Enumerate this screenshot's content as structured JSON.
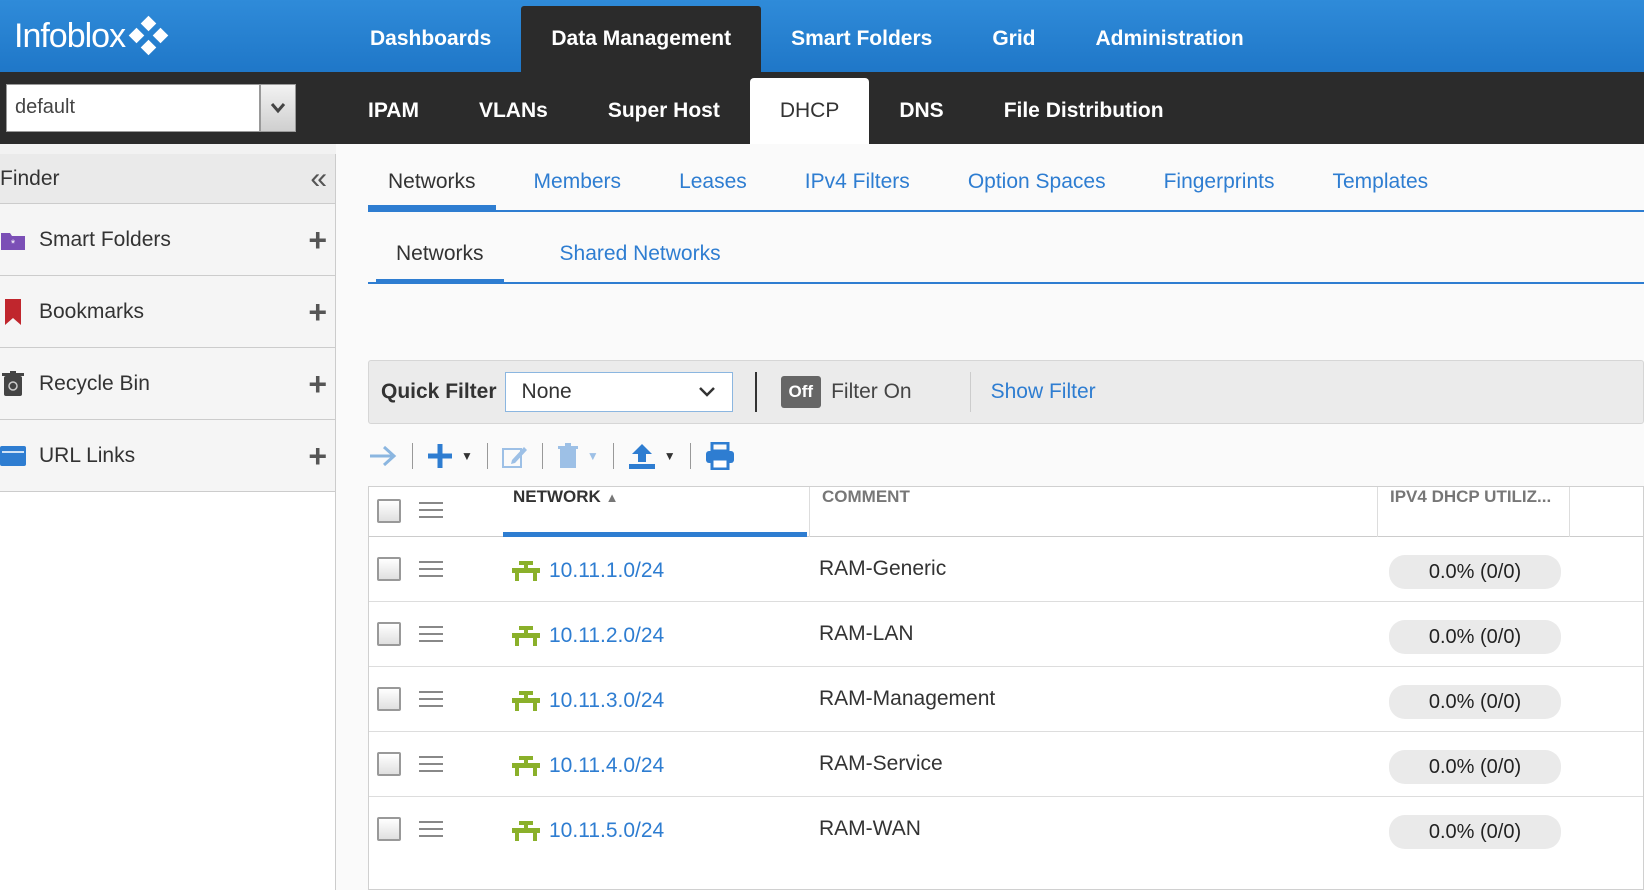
{
  "app": {
    "logo_text": "Infoblox"
  },
  "topnav": {
    "items": [
      "Dashboards",
      "Data Management",
      "Smart Folders",
      "Grid",
      "Administration"
    ],
    "active": "Data Management"
  },
  "subnav": {
    "view_selector_value": "default",
    "items": [
      "IPAM",
      "VLANs",
      "Super Host",
      "DHCP",
      "DNS",
      "File Distribution"
    ],
    "active": "DHCP"
  },
  "finder": {
    "title": "Finder",
    "items": [
      {
        "label": "Smart Folders",
        "icon": "smart-folder-icon"
      },
      {
        "label": "Bookmarks",
        "icon": "bookmark-icon"
      },
      {
        "label": "Recycle Bin",
        "icon": "recycle-bin-icon"
      },
      {
        "label": "URL Links",
        "icon": "url-links-icon"
      }
    ]
  },
  "tabs": {
    "primary": [
      "Networks",
      "Members",
      "Leases",
      "IPv4 Filters",
      "Option Spaces",
      "Fingerprints",
      "Templates"
    ],
    "primary_active": "Networks",
    "secondary": [
      "Networks",
      "Shared Networks"
    ],
    "secondary_active": "Networks"
  },
  "filter": {
    "quick_filter_label": "Quick Filter",
    "quick_filter_value": "None",
    "toggle_state": "Off",
    "filter_on_label": "Filter On",
    "show_filter_label": "Show Filter"
  },
  "grid": {
    "columns": {
      "network": "NETWORK",
      "comment": "COMMENT",
      "utilization": "IPV4 DHCP UTILIZ..."
    },
    "rows": [
      {
        "network": "10.11.1.0/24",
        "comment": "RAM-Generic",
        "utilization": "0.0% (0/0)"
      },
      {
        "network": "10.11.2.0/24",
        "comment": "RAM-LAN",
        "utilization": "0.0% (0/0)"
      },
      {
        "network": "10.11.3.0/24",
        "comment": "RAM-Management",
        "utilization": "0.0% (0/0)"
      },
      {
        "network": "10.11.4.0/24",
        "comment": "RAM-Service",
        "utilization": "0.0% (0/0)"
      },
      {
        "network": "10.11.5.0/24",
        "comment": "RAM-WAN",
        "utilization": "0.0% (0/0)"
      }
    ]
  },
  "colors": {
    "accent": "#2e7dd1",
    "topbar": "#2f8bd9",
    "dark": "#2b2b2b",
    "network_icon": "#8ab02a"
  }
}
